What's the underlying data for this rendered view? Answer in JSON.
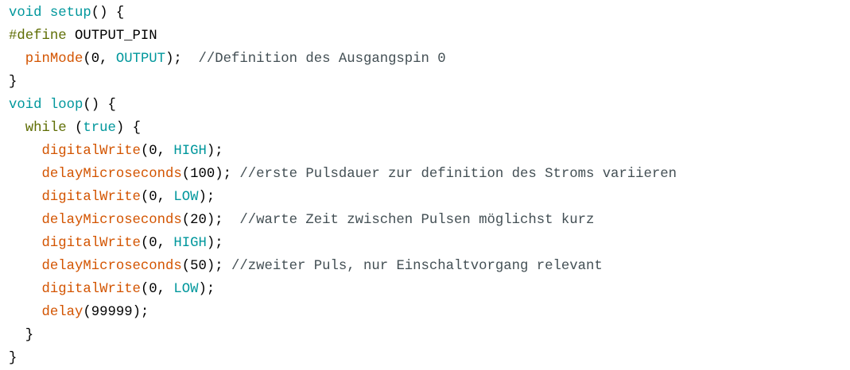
{
  "colors": {
    "keyword": "#00979c",
    "function": "#d35400",
    "constant": "#00979c",
    "preprocessor": "#5e6d03",
    "plain": "#000000",
    "comment": "#434f54",
    "background": "#ffffff"
  },
  "lines": [
    [
      {
        "t": "void",
        "c": "kw"
      },
      {
        "t": " ",
        "c": "tx"
      },
      {
        "t": "setup",
        "c": "kw"
      },
      {
        "t": "() {",
        "c": "tx"
      }
    ],
    [
      {
        "t": "#define",
        "c": "pp"
      },
      {
        "t": " OUTPUT_PIN",
        "c": "tx"
      }
    ],
    [
      {
        "t": "  ",
        "c": "tx"
      },
      {
        "t": "pinMode",
        "c": "fn"
      },
      {
        "t": "(0, ",
        "c": "tx"
      },
      {
        "t": "OUTPUT",
        "c": "ct"
      },
      {
        "t": ");  ",
        "c": "tx"
      },
      {
        "t": "//Definition des Ausgangspin 0",
        "c": "cmt"
      }
    ],
    [
      {
        "t": "}",
        "c": "tx"
      }
    ],
    [
      {
        "t": "void",
        "c": "kw"
      },
      {
        "t": " ",
        "c": "tx"
      },
      {
        "t": "loop",
        "c": "kw"
      },
      {
        "t": "() {",
        "c": "tx"
      }
    ],
    [
      {
        "t": "  ",
        "c": "tx"
      },
      {
        "t": "while",
        "c": "pp"
      },
      {
        "t": " (",
        "c": "tx"
      },
      {
        "t": "true",
        "c": "ct"
      },
      {
        "t": ") {",
        "c": "tx"
      }
    ],
    [
      {
        "t": "    ",
        "c": "tx"
      },
      {
        "t": "digitalWrite",
        "c": "fn"
      },
      {
        "t": "(0, ",
        "c": "tx"
      },
      {
        "t": "HIGH",
        "c": "ct"
      },
      {
        "t": ");",
        "c": "tx"
      }
    ],
    [
      {
        "t": "    ",
        "c": "tx"
      },
      {
        "t": "delayMicroseconds",
        "c": "fn"
      },
      {
        "t": "(100); ",
        "c": "tx"
      },
      {
        "t": "//erste Pulsdauer zur definition des Stroms variieren",
        "c": "cmt"
      }
    ],
    [
      {
        "t": "    ",
        "c": "tx"
      },
      {
        "t": "digitalWrite",
        "c": "fn"
      },
      {
        "t": "(0, ",
        "c": "tx"
      },
      {
        "t": "LOW",
        "c": "ct"
      },
      {
        "t": ");",
        "c": "tx"
      }
    ],
    [
      {
        "t": "    ",
        "c": "tx"
      },
      {
        "t": "delayMicroseconds",
        "c": "fn"
      },
      {
        "t": "(20);  ",
        "c": "tx"
      },
      {
        "t": "//warte Zeit zwischen Pulsen möglichst kurz",
        "c": "cmt"
      }
    ],
    [
      {
        "t": "    ",
        "c": "tx"
      },
      {
        "t": "digitalWrite",
        "c": "fn"
      },
      {
        "t": "(0, ",
        "c": "tx"
      },
      {
        "t": "HIGH",
        "c": "ct"
      },
      {
        "t": ");",
        "c": "tx"
      }
    ],
    [
      {
        "t": "    ",
        "c": "tx"
      },
      {
        "t": "delayMicroseconds",
        "c": "fn"
      },
      {
        "t": "(50); ",
        "c": "tx"
      },
      {
        "t": "//zweiter Puls, nur Einschaltvorgang relevant",
        "c": "cmt"
      }
    ],
    [
      {
        "t": "    ",
        "c": "tx"
      },
      {
        "t": "digitalWrite",
        "c": "fn"
      },
      {
        "t": "(0, ",
        "c": "tx"
      },
      {
        "t": "LOW",
        "c": "ct"
      },
      {
        "t": ");",
        "c": "tx"
      }
    ],
    [
      {
        "t": "    ",
        "c": "tx"
      },
      {
        "t": "delay",
        "c": "fn"
      },
      {
        "t": "(99999);",
        "c": "tx"
      }
    ],
    [
      {
        "t": "  }",
        "c": "tx"
      }
    ],
    [
      {
        "t": "}",
        "c": "tx"
      }
    ]
  ]
}
